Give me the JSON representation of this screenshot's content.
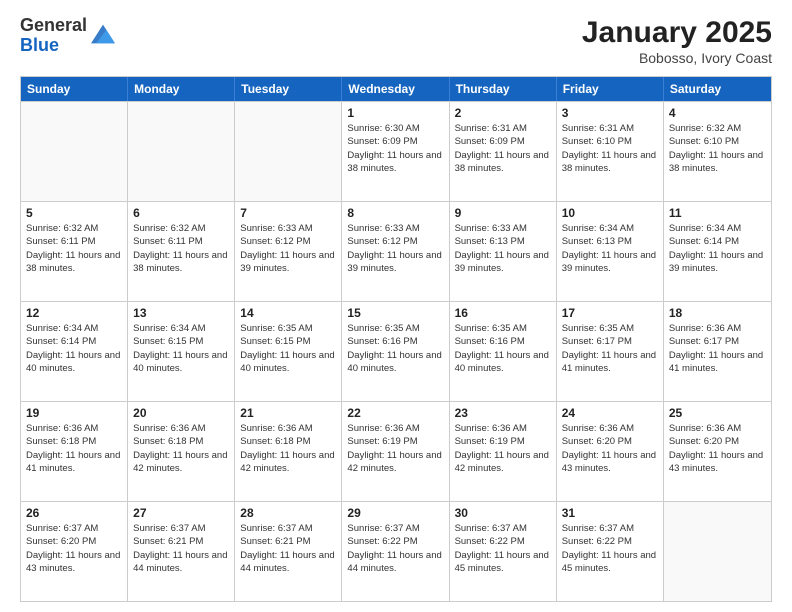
{
  "logo": {
    "general": "General",
    "blue": "Blue"
  },
  "header": {
    "month": "January 2025",
    "location": "Bobosso, Ivory Coast"
  },
  "weekdays": [
    "Sunday",
    "Monday",
    "Tuesday",
    "Wednesday",
    "Thursday",
    "Friday",
    "Saturday"
  ],
  "weeks": [
    [
      {
        "day": "",
        "info": ""
      },
      {
        "day": "",
        "info": ""
      },
      {
        "day": "",
        "info": ""
      },
      {
        "day": "1",
        "info": "Sunrise: 6:30 AM\nSunset: 6:09 PM\nDaylight: 11 hours and 38 minutes."
      },
      {
        "day": "2",
        "info": "Sunrise: 6:31 AM\nSunset: 6:09 PM\nDaylight: 11 hours and 38 minutes."
      },
      {
        "day": "3",
        "info": "Sunrise: 6:31 AM\nSunset: 6:10 PM\nDaylight: 11 hours and 38 minutes."
      },
      {
        "day": "4",
        "info": "Sunrise: 6:32 AM\nSunset: 6:10 PM\nDaylight: 11 hours and 38 minutes."
      }
    ],
    [
      {
        "day": "5",
        "info": "Sunrise: 6:32 AM\nSunset: 6:11 PM\nDaylight: 11 hours and 38 minutes."
      },
      {
        "day": "6",
        "info": "Sunrise: 6:32 AM\nSunset: 6:11 PM\nDaylight: 11 hours and 38 minutes."
      },
      {
        "day": "7",
        "info": "Sunrise: 6:33 AM\nSunset: 6:12 PM\nDaylight: 11 hours and 39 minutes."
      },
      {
        "day": "8",
        "info": "Sunrise: 6:33 AM\nSunset: 6:12 PM\nDaylight: 11 hours and 39 minutes."
      },
      {
        "day": "9",
        "info": "Sunrise: 6:33 AM\nSunset: 6:13 PM\nDaylight: 11 hours and 39 minutes."
      },
      {
        "day": "10",
        "info": "Sunrise: 6:34 AM\nSunset: 6:13 PM\nDaylight: 11 hours and 39 minutes."
      },
      {
        "day": "11",
        "info": "Sunrise: 6:34 AM\nSunset: 6:14 PM\nDaylight: 11 hours and 39 minutes."
      }
    ],
    [
      {
        "day": "12",
        "info": "Sunrise: 6:34 AM\nSunset: 6:14 PM\nDaylight: 11 hours and 40 minutes."
      },
      {
        "day": "13",
        "info": "Sunrise: 6:34 AM\nSunset: 6:15 PM\nDaylight: 11 hours and 40 minutes."
      },
      {
        "day": "14",
        "info": "Sunrise: 6:35 AM\nSunset: 6:15 PM\nDaylight: 11 hours and 40 minutes."
      },
      {
        "day": "15",
        "info": "Sunrise: 6:35 AM\nSunset: 6:16 PM\nDaylight: 11 hours and 40 minutes."
      },
      {
        "day": "16",
        "info": "Sunrise: 6:35 AM\nSunset: 6:16 PM\nDaylight: 11 hours and 40 minutes."
      },
      {
        "day": "17",
        "info": "Sunrise: 6:35 AM\nSunset: 6:17 PM\nDaylight: 11 hours and 41 minutes."
      },
      {
        "day": "18",
        "info": "Sunrise: 6:36 AM\nSunset: 6:17 PM\nDaylight: 11 hours and 41 minutes."
      }
    ],
    [
      {
        "day": "19",
        "info": "Sunrise: 6:36 AM\nSunset: 6:18 PM\nDaylight: 11 hours and 41 minutes."
      },
      {
        "day": "20",
        "info": "Sunrise: 6:36 AM\nSunset: 6:18 PM\nDaylight: 11 hours and 42 minutes."
      },
      {
        "day": "21",
        "info": "Sunrise: 6:36 AM\nSunset: 6:18 PM\nDaylight: 11 hours and 42 minutes."
      },
      {
        "day": "22",
        "info": "Sunrise: 6:36 AM\nSunset: 6:19 PM\nDaylight: 11 hours and 42 minutes."
      },
      {
        "day": "23",
        "info": "Sunrise: 6:36 AM\nSunset: 6:19 PM\nDaylight: 11 hours and 42 minutes."
      },
      {
        "day": "24",
        "info": "Sunrise: 6:36 AM\nSunset: 6:20 PM\nDaylight: 11 hours and 43 minutes."
      },
      {
        "day": "25",
        "info": "Sunrise: 6:36 AM\nSunset: 6:20 PM\nDaylight: 11 hours and 43 minutes."
      }
    ],
    [
      {
        "day": "26",
        "info": "Sunrise: 6:37 AM\nSunset: 6:20 PM\nDaylight: 11 hours and 43 minutes."
      },
      {
        "day": "27",
        "info": "Sunrise: 6:37 AM\nSunset: 6:21 PM\nDaylight: 11 hours and 44 minutes."
      },
      {
        "day": "28",
        "info": "Sunrise: 6:37 AM\nSunset: 6:21 PM\nDaylight: 11 hours and 44 minutes."
      },
      {
        "day": "29",
        "info": "Sunrise: 6:37 AM\nSunset: 6:22 PM\nDaylight: 11 hours and 44 minutes."
      },
      {
        "day": "30",
        "info": "Sunrise: 6:37 AM\nSunset: 6:22 PM\nDaylight: 11 hours and 45 minutes."
      },
      {
        "day": "31",
        "info": "Sunrise: 6:37 AM\nSunset: 6:22 PM\nDaylight: 11 hours and 45 minutes."
      },
      {
        "day": "",
        "info": ""
      }
    ]
  ]
}
